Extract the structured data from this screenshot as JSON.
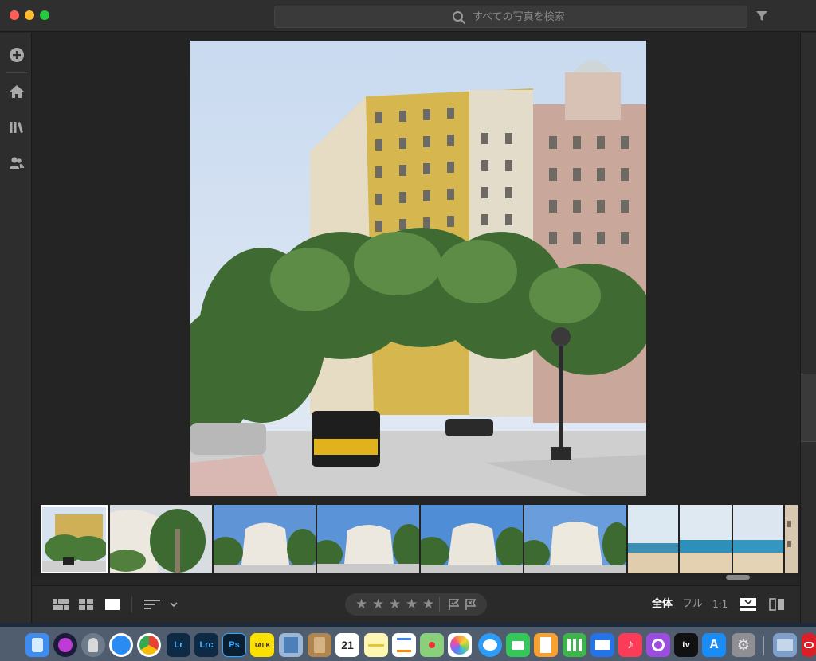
{
  "window": {
    "search": {
      "placeholder": "すべての写真を検索"
    }
  },
  "sidebar": {
    "items": [
      {
        "name": "add",
        "icon": "plus-circle-icon"
      },
      {
        "name": "home",
        "icon": "home-icon"
      },
      {
        "name": "library",
        "icon": "library-icon"
      },
      {
        "name": "people",
        "icon": "people-icon"
      }
    ]
  },
  "filmstrip": {
    "thumbnails": [
      {
        "subject": "yellow building street corner",
        "selected": true
      },
      {
        "subject": "white wavy building with trees"
      },
      {
        "subject": "white wavy building blue sky"
      },
      {
        "subject": "white wavy building blue sky"
      },
      {
        "subject": "white wavy building blue sky"
      },
      {
        "subject": "white wavy building blue sky"
      },
      {
        "subject": "beach"
      },
      {
        "subject": "beach"
      },
      {
        "subject": "beach"
      },
      {
        "subject": "building edge"
      }
    ]
  },
  "toolbar": {
    "rating_stars": [
      "★",
      "★",
      "★",
      "★",
      "★"
    ],
    "zoom": {
      "fit_label": "全体",
      "fill_label": "フル",
      "one_to_one_label": "1:1"
    }
  },
  "dock": {
    "apps": [
      {
        "name": "Finder",
        "label": ""
      },
      {
        "name": "Siri",
        "label": ""
      },
      {
        "name": "Launchpad",
        "label": ""
      },
      {
        "name": "Safari",
        "label": ""
      },
      {
        "name": "Chrome",
        "label": ""
      },
      {
        "name": "Lightroom",
        "label": "Lr"
      },
      {
        "name": "Lightroom Classic",
        "label": "Lrc"
      },
      {
        "name": "Photoshop",
        "label": "Ps"
      },
      {
        "name": "KakaoTalk",
        "label": "TALK"
      },
      {
        "name": "Preview",
        "label": ""
      },
      {
        "name": "Contacts",
        "label": ""
      },
      {
        "name": "Calendar",
        "label": "21"
      },
      {
        "name": "Notes",
        "label": ""
      },
      {
        "name": "Reminders",
        "label": ""
      },
      {
        "name": "Maps",
        "label": ""
      },
      {
        "name": "Photos",
        "label": ""
      },
      {
        "name": "Messages",
        "label": ""
      },
      {
        "name": "FaceTime",
        "label": ""
      },
      {
        "name": "Pages",
        "label": ""
      },
      {
        "name": "Numbers",
        "label": ""
      },
      {
        "name": "Keynote",
        "label": ""
      },
      {
        "name": "Music",
        "label": ""
      },
      {
        "name": "Podcasts",
        "label": ""
      },
      {
        "name": "Apple TV",
        "label": "tv"
      },
      {
        "name": "App Store",
        "label": ""
      },
      {
        "name": "System Preferences",
        "label": ""
      },
      {
        "name": "Screenshot",
        "label": ""
      },
      {
        "name": "Creative Cloud",
        "label": ""
      }
    ]
  },
  "colors": {
    "accent": "#ffffff",
    "background": "#252525",
    "panel": "#2d2d2d"
  }
}
